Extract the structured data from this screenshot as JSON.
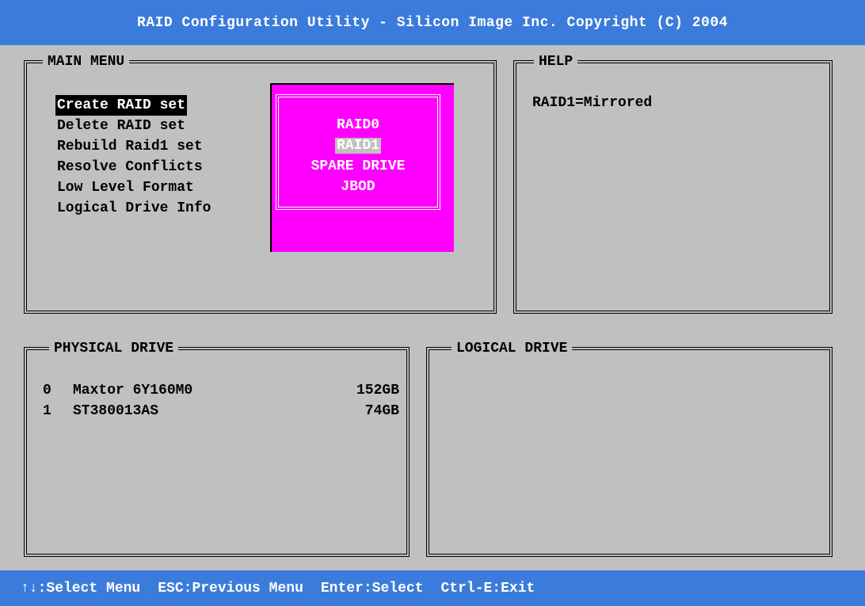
{
  "title": "RAID Configuration Utility - Silicon Image Inc. Copyright (C) 2004",
  "main_menu": {
    "title": "MAIN MENU",
    "items": [
      {
        "label": "Create RAID set"
      },
      {
        "label": "Delete RAID set"
      },
      {
        "label": "Rebuild Raid1 set"
      },
      {
        "label": "Resolve Conflicts"
      },
      {
        "label": "Low Level Format"
      },
      {
        "label": "Logical Drive Info"
      }
    ],
    "selected_index": 0
  },
  "raid_popup": {
    "options": [
      {
        "label": "RAID0"
      },
      {
        "label": "RAID1"
      },
      {
        "label": "SPARE DRIVE"
      },
      {
        "label": "JBOD"
      }
    ],
    "selected_index": 1
  },
  "help": {
    "title": "HELP",
    "text": "RAID1=Mirrored"
  },
  "physical_drive": {
    "title": "PHYSICAL DRIVE",
    "drives": [
      {
        "id": "0",
        "model": "Maxtor 6Y160M0",
        "size": "152GB"
      },
      {
        "id": "1",
        "model": "ST380013AS",
        "size": "74GB"
      }
    ]
  },
  "logical_drive": {
    "title": "LOGICAL DRIVE"
  },
  "status_bar": {
    "items": [
      {
        "text": "↑↓:Select Menu"
      },
      {
        "text": "ESC:Previous Menu"
      },
      {
        "text": "Enter:Select"
      },
      {
        "text": "Ctrl-E:Exit"
      }
    ]
  },
  "colors": {
    "bar": "#3b7bdb",
    "background": "#c0c0c0",
    "popup": "#ff00ff"
  }
}
